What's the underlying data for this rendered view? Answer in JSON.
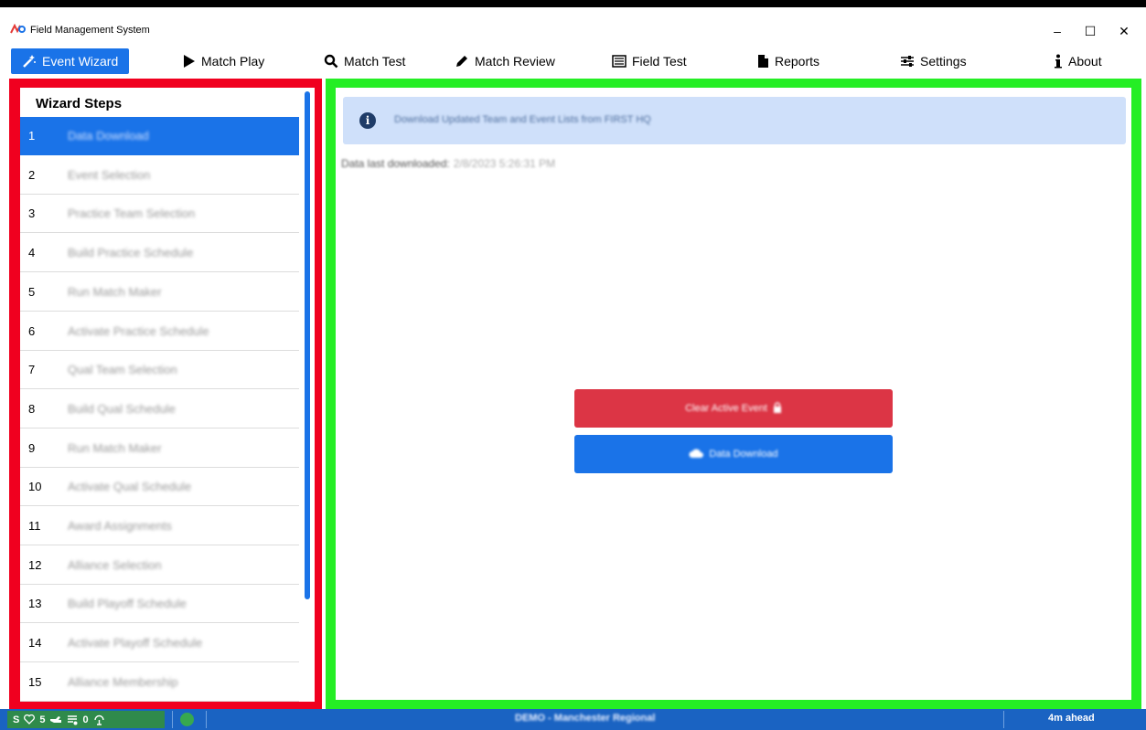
{
  "window": {
    "title": "Field Management System",
    "controls": {
      "minimize": "–",
      "maximize": "☐",
      "close": "✕"
    }
  },
  "nav": {
    "items": [
      {
        "label": "Event Wizard",
        "icon": "magic-wand-icon",
        "active": true
      },
      {
        "label": "Match Play",
        "icon": "play-icon"
      },
      {
        "label": "Match Test",
        "icon": "search-icon"
      },
      {
        "label": "Match Review",
        "icon": "pencil-icon"
      },
      {
        "label": "Field Test",
        "icon": "list-box-icon"
      },
      {
        "label": "Reports",
        "icon": "file-icon"
      },
      {
        "label": "Settings",
        "icon": "sliders-icon"
      },
      {
        "label": "About",
        "icon": "info-icon"
      }
    ]
  },
  "sidebar": {
    "title": "Wizard Steps",
    "steps": [
      {
        "num": "1",
        "label": "Data Download"
      },
      {
        "num": "2",
        "label": "Event Selection"
      },
      {
        "num": "3",
        "label": "Practice Team Selection"
      },
      {
        "num": "4",
        "label": "Build Practice Schedule"
      },
      {
        "num": "5",
        "label": "Run Match Maker"
      },
      {
        "num": "6",
        "label": "Activate Practice Schedule"
      },
      {
        "num": "7",
        "label": "Qual Team Selection"
      },
      {
        "num": "8",
        "label": "Build Qual Schedule"
      },
      {
        "num": "9",
        "label": "Run Match Maker"
      },
      {
        "num": "10",
        "label": "Activate Qual Schedule"
      },
      {
        "num": "11",
        "label": "Award Assignments"
      },
      {
        "num": "12",
        "label": "Alliance Selection"
      },
      {
        "num": "13",
        "label": "Build Playoff Schedule"
      },
      {
        "num": "14",
        "label": "Activate Playoff Schedule"
      },
      {
        "num": "15",
        "label": "Alliance Membership"
      }
    ]
  },
  "main": {
    "info": "Download Updated Team and Event Lists from FIRST HQ",
    "last_downloaded_label": "Data last downloaded:",
    "last_downloaded_value": "2/8/2023 5:26:31 PM",
    "clear_button": "Clear Active Event",
    "download_button": "Data Download"
  },
  "status": {
    "s": "S",
    "hearts": "5",
    "fields": "0",
    "event": "DEMO - Manchester Regional",
    "time": "4m ahead"
  },
  "colors": {
    "accent": "#1a73e8",
    "sidebar_frame": "#f0001f",
    "main_frame": "#25ee25",
    "danger": "#dc3545",
    "statusbar": "#1a63c2"
  }
}
